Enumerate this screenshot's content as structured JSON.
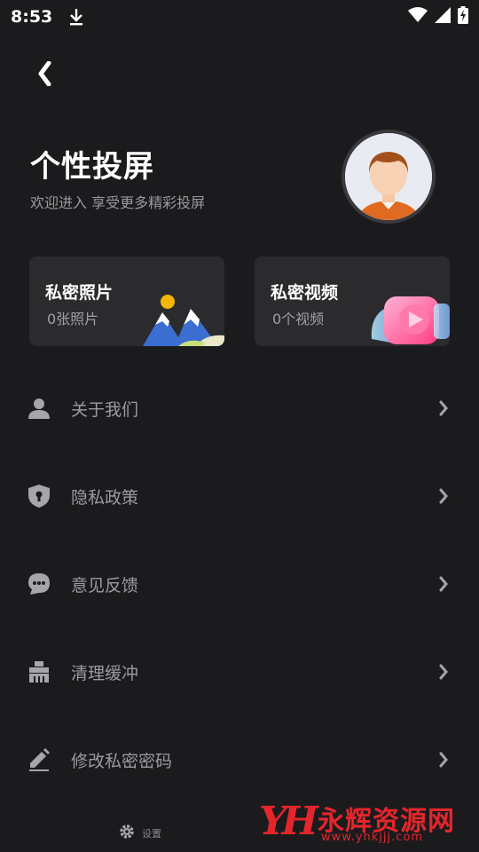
{
  "status_bar": {
    "time": "8:53",
    "icons": [
      "download-icon",
      "wifi-icon",
      "signal-icon",
      "battery-charging-icon"
    ]
  },
  "header": {
    "back_icon": "back-arrow-icon",
    "title": "个性投屏",
    "subtitle": "欢迎进入  享受更多精彩投屏"
  },
  "cards": [
    {
      "title": "私密照片",
      "count": "0张照片",
      "icon": "mountain-illustration"
    },
    {
      "title": "私密视频",
      "count": "0个视频",
      "icon": "video-play-illustration"
    }
  ],
  "menu": {
    "items": [
      {
        "label": "关于我们",
        "icon": "person-icon"
      },
      {
        "label": "隐私政策",
        "icon": "shield-lock-icon"
      },
      {
        "label": "意见反馈",
        "icon": "chat-bubble-icon"
      },
      {
        "label": "清理缓冲",
        "icon": "broom-icon"
      },
      {
        "label": "修改私密密码",
        "icon": "edit-pencil-icon"
      }
    ]
  },
  "footer": {
    "settings_label": "设置",
    "settings_icon": "gear-icon"
  },
  "watermark": {
    "logo": "YH",
    "text": "永辉资源网",
    "url": "www.yhkjjj.com"
  },
  "colors": {
    "background": "#1b1b1d",
    "card": "#2b2b2e",
    "muted_text": "#9c9ca0",
    "watermark_red": "#e3262c"
  }
}
